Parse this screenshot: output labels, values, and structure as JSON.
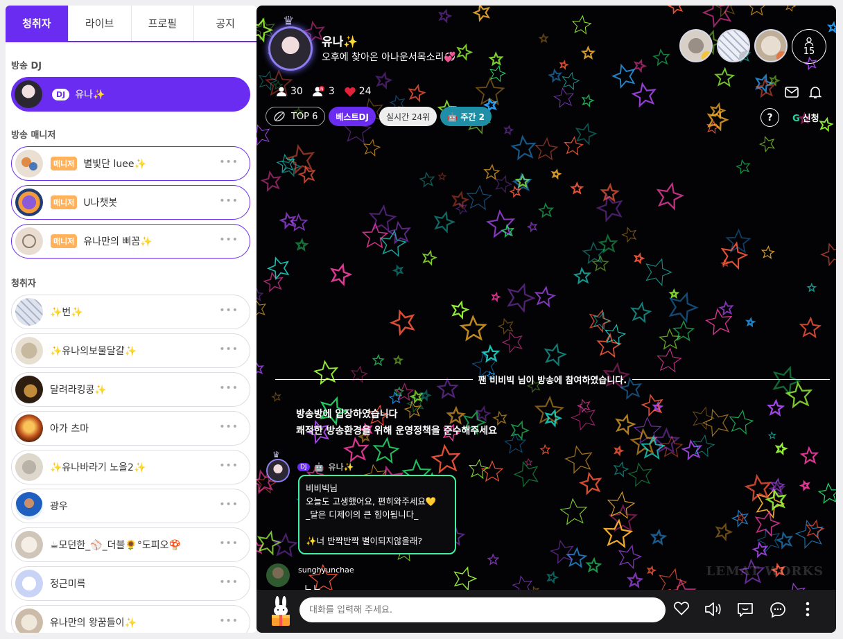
{
  "tabs": [
    "청취자",
    "라이브",
    "프로필",
    "공지"
  ],
  "left": {
    "dj_section": "방송 DJ",
    "dj": {
      "badge": "DJ",
      "name": "유나✨"
    },
    "manager_section": "방송 매니저",
    "managers": [
      {
        "badge": "매니저",
        "name": "별빛단 luee✨"
      },
      {
        "badge": "매니저",
        "name": "U나챗봇"
      },
      {
        "badge": "매니저",
        "name": "유나만의 삐꼼✨"
      }
    ],
    "listener_section": "청취자",
    "listeners": [
      {
        "name": "✨번✨"
      },
      {
        "name": "✨유나의보물달걀✨"
      },
      {
        "name": "달려라킹콩✨"
      },
      {
        "name": "아가 츠마"
      },
      {
        "name": "✨유나바라기  노을2✨"
      },
      {
        "name": "광우"
      },
      {
        "name": "☕모던한_⚾_더블🌻°도피오🍄"
      },
      {
        "name": "정근미륵"
      },
      {
        "name": "유나만의 왕꿈들이✨"
      }
    ],
    "more_label": "•••"
  },
  "broadcast": {
    "bj_name": "유나✨",
    "title": "오후에 찾아온 아나운서목소리💞",
    "listener_count": "15",
    "stats": {
      "listeners": "30",
      "fans": "3",
      "likes": "24"
    },
    "chips": {
      "top": "TOP 6",
      "best": "베스트DJ",
      "realtime": "실시간 24위",
      "weekly": "🤖 주간 2"
    },
    "help": "?",
    "apply": "신청",
    "join_notice": "팬 비비빅 님이 방송에 참여하였습니다.",
    "notice_line1": "방송방에 입장하였습니다",
    "notice_line2": "쾌적한 방송환경을 위해 운영정책을 준수해주세요",
    "message": {
      "badge": "DJ",
      "author": "유나✨",
      "line1": "비비빅님",
      "line2": "오늘도 고생했어요, 편히와주세요💛",
      "line3": "_달은 디제이의 큰 힘이됩니다_",
      "line4": "✨너 반짝반짝 별이되지않을래?"
    },
    "user2": {
      "name": "sunghyunchae",
      "text": "ㄴㄴ"
    },
    "watermark": "LEMAT WORKS",
    "input_placeholder": "대화를 입력해 주세요."
  },
  "colors": {
    "accent": "#6a2cf0",
    "manager_badge": "#ffb15c",
    "bubble_border": "#3ef2a4",
    "weekly_chip": "#1e8fa6"
  }
}
